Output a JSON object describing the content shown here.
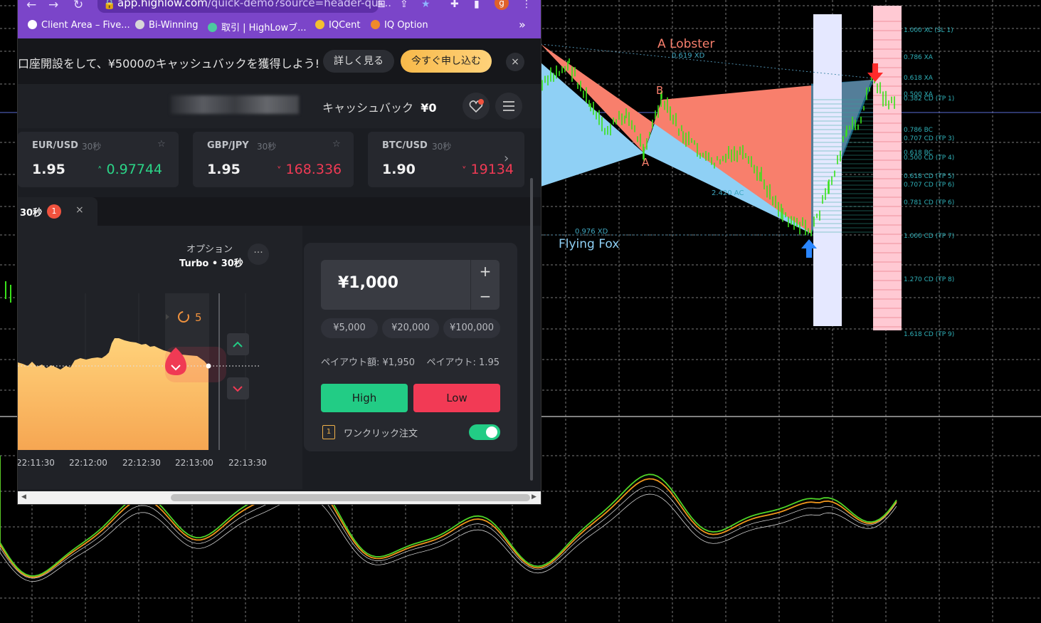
{
  "browser": {
    "url_host": "app.highlow.com",
    "url_path": "/quick-demo?source=header-qui...",
    "avatar": "g",
    "bookmarks": [
      {
        "label": "Client Area – Five...",
        "color": "#ffffff"
      },
      {
        "label": "Bi-Winning",
        "color": "#d8d8d8"
      },
      {
        "label": "取引 | HighLowブ...",
        "color": "#4cc9a0"
      },
      {
        "label": "IQCent",
        "color": "#f3c030"
      },
      {
        "label": "IQ Option",
        "color": "#f08a2a"
      }
    ],
    "more": "»"
  },
  "promo": {
    "text": "口座開設をして、¥5000のキャッシュバックを獲得しよう!",
    "detail_label": "詳しく見る",
    "apply_label": "今すぐ申し込む",
    "close": "×"
  },
  "header": {
    "cashback_label": "キャッシュバック",
    "cashback_value": "¥0"
  },
  "assets": [
    {
      "symbol": "EUR/USD",
      "duration": "30秒",
      "payout": "1.95",
      "price": "0.97744",
      "direction": "up",
      "arrow": "˄"
    },
    {
      "symbol": "GBP/JPY",
      "duration": "30秒",
      "payout": "1.95",
      "price": "168.336",
      "direction": "down",
      "arrow": "˅"
    },
    {
      "symbol": "BTC/USD",
      "duration": "30秒",
      "payout": "1.90",
      "price": "19134",
      "direction": "down",
      "arrow": "˅"
    }
  ],
  "tab": {
    "label": "30秒",
    "badge": "1",
    "close": "×"
  },
  "option": {
    "title": "オプション",
    "subtitle": "Turbo • 30秒",
    "countdown": "5",
    "times": [
      "22:11:30",
      "22:12:00",
      "22:12:30",
      "22:13:00",
      "22:13:30"
    ]
  },
  "trade": {
    "amount": "¥1,000",
    "plus": "+",
    "minus": "−",
    "presets": [
      "¥5,000",
      "¥20,000",
      "¥100,000"
    ],
    "payout_amount_label": "ペイアウト額: ¥1,950",
    "payout_label": "ペイアウト: 1.95",
    "high_label": "High",
    "low_label": "Low",
    "oneclick_label": "ワンクリック注文",
    "oneclick_enabled": true
  },
  "mt_chart": {
    "pattern_top": "A Lobster",
    "pattern_bottom": "Flying Fox",
    "point_a_top": "A",
    "point_b": "B",
    "point_a_bottom": "A",
    "ratio_xd_top": "0.619 XD",
    "ratio_ac": "2.420 AC",
    "ratio_xd_bottom": "0.976 XD",
    "levels_right": [
      "1.000 XC (SL 1)",
      "0.786 XA",
      "0.618 XA",
      "0.500 XA",
      "0.382 CD (TP 1)",
      "0.786 BC",
      "0.707 CD (TP 3)",
      "0.618 BC",
      "0.500 CD (TP 4)",
      "0.618 CD (TP 5)",
      "0.707 CD (TP 6)",
      "0.781 CD (TP 6)",
      "1.000 CD (TP 7)",
      "1.270 CD (TP 8)",
      "1.618 CD (TP 9)"
    ],
    "colors": {
      "red_zone": "#f87f6c",
      "blue_zone": "#8fd0f5",
      "candles": "#39e21a",
      "tp_band": "#ffc9d3",
      "sl_band": "#e5e8ff",
      "osc_orange": "#f0961c",
      "osc_green": "#4ed428"
    }
  }
}
